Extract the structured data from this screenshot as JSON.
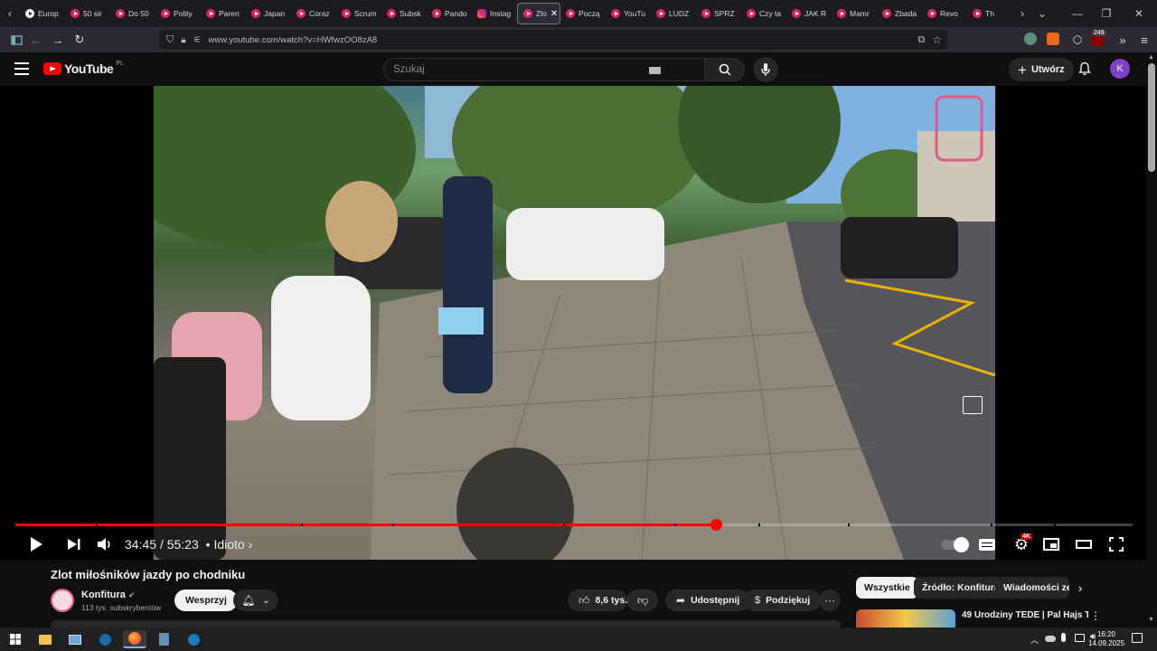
{
  "browser": {
    "tabs": [
      {
        "label": "Europ",
        "icon": "dark"
      },
      {
        "label": "50 sir",
        "icon": "yt"
      },
      {
        "label": "Do 50",
        "icon": "yt"
      },
      {
        "label": "Polity",
        "icon": "yt"
      },
      {
        "label": "Paren",
        "icon": "yt"
      },
      {
        "label": "Japan",
        "icon": "yt"
      },
      {
        "label": "Coraz",
        "icon": "yt"
      },
      {
        "label": "Scrum",
        "icon": "yt"
      },
      {
        "label": "Subsk",
        "icon": "yt"
      },
      {
        "label": "Pando",
        "icon": "yt"
      },
      {
        "label": "Instag",
        "icon": "insta"
      },
      {
        "label": "Zlo",
        "icon": "yt",
        "active": true
      },
      {
        "label": "Począ",
        "icon": "yt"
      },
      {
        "label": "YouTu",
        "icon": "yt"
      },
      {
        "label": "LUDZ",
        "icon": "yt"
      },
      {
        "label": "SPRZ",
        "icon": "yt"
      },
      {
        "label": "Czy ta",
        "icon": "yt"
      },
      {
        "label": "JAK R",
        "icon": "yt"
      },
      {
        "label": "Mamr",
        "icon": "yt"
      },
      {
        "label": "Zbada",
        "icon": "yt"
      },
      {
        "label": "Revo",
        "icon": "yt"
      },
      {
        "label": "Th",
        "icon": "yt"
      }
    ],
    "url": "www.youtube.com/watch?v=HWfwzOO8zA8",
    "ext_badge": "249"
  },
  "youtube": {
    "logo_text": "YouTube",
    "region": "PL",
    "search_placeholder": "Szukaj",
    "create_label": "Utwórz",
    "avatar_letter": "K"
  },
  "player": {
    "current_time": "34:45",
    "duration": "55:23",
    "chapter": "• Idioto ›",
    "progress_fraction": 0.627,
    "quality_badge": "4K",
    "chapter_marks": [
      0.072,
      0.256,
      0.337,
      0.49,
      0.59,
      0.665,
      0.745,
      0.873,
      0.93
    ]
  },
  "video": {
    "title": "Zlot miłośników jazdy po chodniku",
    "channel": "Konfitura",
    "subscribers": "113 tys. subskrybentów",
    "support_label": "Wesprzyj",
    "likes": "8,6 tys.",
    "share_label": "Udostępnij",
    "thanks_label": "Podziękuj"
  },
  "sidebar": {
    "chips": [
      "Wszystkie",
      "Źródło: Konfitura",
      "Wiadomości ze ś"
    ],
    "rec_title": "49 Urodziny TEDE | Pal Hajs TV"
  },
  "taskbar": {
    "time": "16:20",
    "date": "14.09.2025"
  },
  "colors": {
    "accent": "#ff0000",
    "background": "#0f0f0f"
  }
}
